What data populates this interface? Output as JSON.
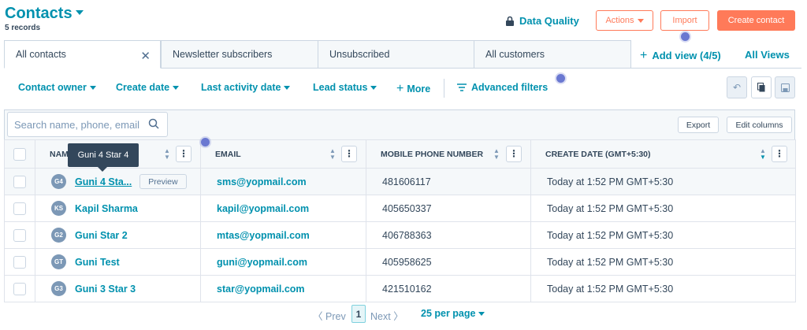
{
  "header": {
    "title": "Contacts",
    "records": "5 records",
    "data_quality": "Data Quality",
    "actions": "Actions",
    "import": "Import",
    "create": "Create contact"
  },
  "tabs": [
    {
      "label": "All contacts"
    },
    {
      "label": "Newsletter subscribers"
    },
    {
      "label": "Unsubscribed"
    },
    {
      "label": "All customers"
    }
  ],
  "views": {
    "add": "Add view (4/5)",
    "all": "All Views"
  },
  "filters": {
    "owner": "Contact owner",
    "create_date": "Create date",
    "last_activity": "Last activity date",
    "lead_status": "Lead status",
    "more": "More",
    "advanced": "Advanced filters"
  },
  "table_tools": {
    "search_placeholder": "Search name, phone, email",
    "export": "Export",
    "edit_columns": "Edit columns"
  },
  "columns": {
    "name": "NAME",
    "email": "EMAIL",
    "phone": "MOBILE PHONE NUMBER",
    "create_date": "CREATE DATE (GMT+5:30)"
  },
  "rows": [
    {
      "initials": "G4",
      "name": "Guni 4 Sta...",
      "email": "sms@yopmail.com",
      "phone": "481606117",
      "date": "Today at 1:52 PM GMT+5:30"
    },
    {
      "initials": "KS",
      "name": "Kapil Sharma",
      "email": "kapil@yopmail.com",
      "phone": "405650337",
      "date": "Today at 1:52 PM GMT+5:30"
    },
    {
      "initials": "G2",
      "name": "Guni Star 2",
      "email": "mtas@yopmail.com",
      "phone": "406788363",
      "date": "Today at 1:52 PM GMT+5:30"
    },
    {
      "initials": "GT",
      "name": "Guni Test",
      "email": "guni@yopmail.com",
      "phone": "405958625",
      "date": "Today at 1:52 PM GMT+5:30"
    },
    {
      "initials": "G3",
      "name": "Guni 3 Star 3",
      "email": "star@yopmail.com",
      "phone": "421510162",
      "date": "Today at 1:52 PM GMT+5:30"
    }
  ],
  "preview_label": "Preview",
  "tooltip": "Guni 4 Star 4",
  "pagination": {
    "prev": "Prev",
    "page": "1",
    "next": "Next",
    "per_page": "25 per page"
  },
  "colors": {
    "accent": "#0091ae",
    "brand": "#ff7a59",
    "indicator": "#6a78d1"
  }
}
